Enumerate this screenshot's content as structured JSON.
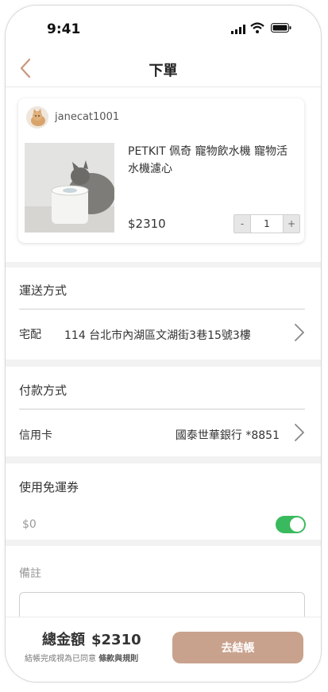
{
  "status_bar": {
    "time": "9:41"
  },
  "header": {
    "title": "下單"
  },
  "order": {
    "seller": "janecat1001",
    "product_name": "PETKIT 佩奇 寵物飲水機 寵物活水機濾心",
    "price": "$2310",
    "quantity": "1",
    "minus": "-",
    "plus": "+"
  },
  "shipping": {
    "label": "運送方式",
    "method": "宅配",
    "address": "114 台北市內湖區文湖街3巷15號3樓"
  },
  "payment": {
    "label": "付款方式",
    "method": "信用卡",
    "account": "國泰世華銀行 *8851"
  },
  "coupon": {
    "label": "使用免運券",
    "amount": "$0",
    "enabled": true
  },
  "notes": {
    "label": "備註"
  },
  "footer": {
    "total_label": "總金額",
    "total_amount": "$2310",
    "agree_text": "結帳完成視為已同意 ",
    "terms_link": "條款與規則",
    "checkout_label": "去結帳"
  },
  "colors": {
    "accent": "#c9a28d",
    "toggle_on": "#3aba5e"
  }
}
